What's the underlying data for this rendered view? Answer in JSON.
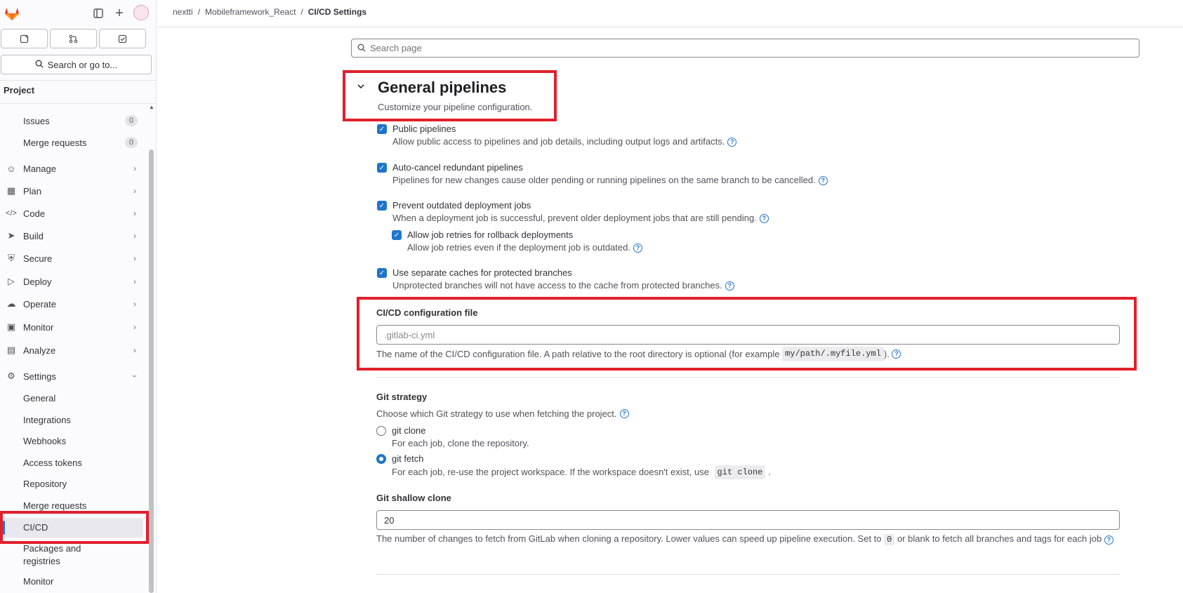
{
  "topbar": {
    "breadcrumb": [
      "nextti",
      "Mobileframework_React",
      "CI/CD Settings"
    ],
    "separator": "/"
  },
  "sidebar": {
    "search_label": "Search or go to...",
    "section_title": "Project",
    "items_top": [
      {
        "label": "Issues",
        "count": "0"
      },
      {
        "label": "Merge requests",
        "count": "0"
      }
    ],
    "nav": [
      {
        "label": "Manage",
        "icon": "users-icon"
      },
      {
        "label": "Plan",
        "icon": "calendar-icon"
      },
      {
        "label": "Code",
        "icon": "code-icon"
      },
      {
        "label": "Build",
        "icon": "rocket-icon"
      },
      {
        "label": "Secure",
        "icon": "shield-icon"
      },
      {
        "label": "Deploy",
        "icon": "deploy-icon"
      },
      {
        "label": "Operate",
        "icon": "cloud-gear-icon"
      },
      {
        "label": "Monitor",
        "icon": "monitor-icon"
      },
      {
        "label": "Analyze",
        "icon": "chart-icon"
      },
      {
        "label": "Settings",
        "icon": "gear-icon"
      }
    ],
    "settings_sub": [
      "General",
      "Integrations",
      "Webhooks",
      "Access tokens",
      "Repository",
      "Merge requests",
      "CI/CD",
      "Packages and registries",
      "Monitor"
    ],
    "active_sub": "CI/CD"
  },
  "main": {
    "search_placeholder": "Search page",
    "section": {
      "title": "General pipelines",
      "description": "Customize your pipeline configuration."
    },
    "checkboxes": [
      {
        "label": "Public pipelines",
        "help": "Allow public access to pipelines and job details, including output logs and artifacts.",
        "checked": true
      },
      {
        "label": "Auto-cancel redundant pipelines",
        "help": "Pipelines for new changes cause older pending or running pipelines on the same branch to be cancelled.",
        "checked": true
      },
      {
        "label": "Prevent outdated deployment jobs",
        "help": "When a deployment job is successful, prevent older deployment jobs that are still pending.",
        "checked": true
      },
      {
        "label": "Allow job retries for rollback deployments",
        "help": "Allow job retries even if the deployment job is outdated.",
        "checked": true
      },
      {
        "label": "Use separate caches for protected branches",
        "help": "Unprotected branches will not have access to the cache from protected branches.",
        "checked": true
      }
    ],
    "config_file": {
      "label": "CI/CD configuration file",
      "placeholder": ".gitlab-ci.yml",
      "help_before": "The name of the CI/CD configuration file. A path relative to the root directory is optional (for example ",
      "help_code": "my/path/.myfile.yml",
      "help_after": ")."
    },
    "git_strategy": {
      "label": "Git strategy",
      "help": "Choose which Git strategy to use when fetching the project.",
      "options": [
        {
          "label": "git clone",
          "help": "For each job, clone the repository.",
          "selected": false
        },
        {
          "label": "git fetch",
          "help_before": "For each job, re-use the project workspace. If the workspace doesn't exist, use ",
          "help_code": "git clone",
          "help_after": ".",
          "selected": true
        }
      ]
    },
    "shallow_clone": {
      "label": "Git shallow clone",
      "value": "20",
      "help_before": "The number of changes to fetch from GitLab when cloning a repository. Lower values can speed up pipeline execution. Set to ",
      "help_code": "0",
      "help_after": " or blank to fetch all branches and tags for each job"
    }
  },
  "colors": {
    "accent": "#1f75cb",
    "highlight": "#e0202c"
  }
}
